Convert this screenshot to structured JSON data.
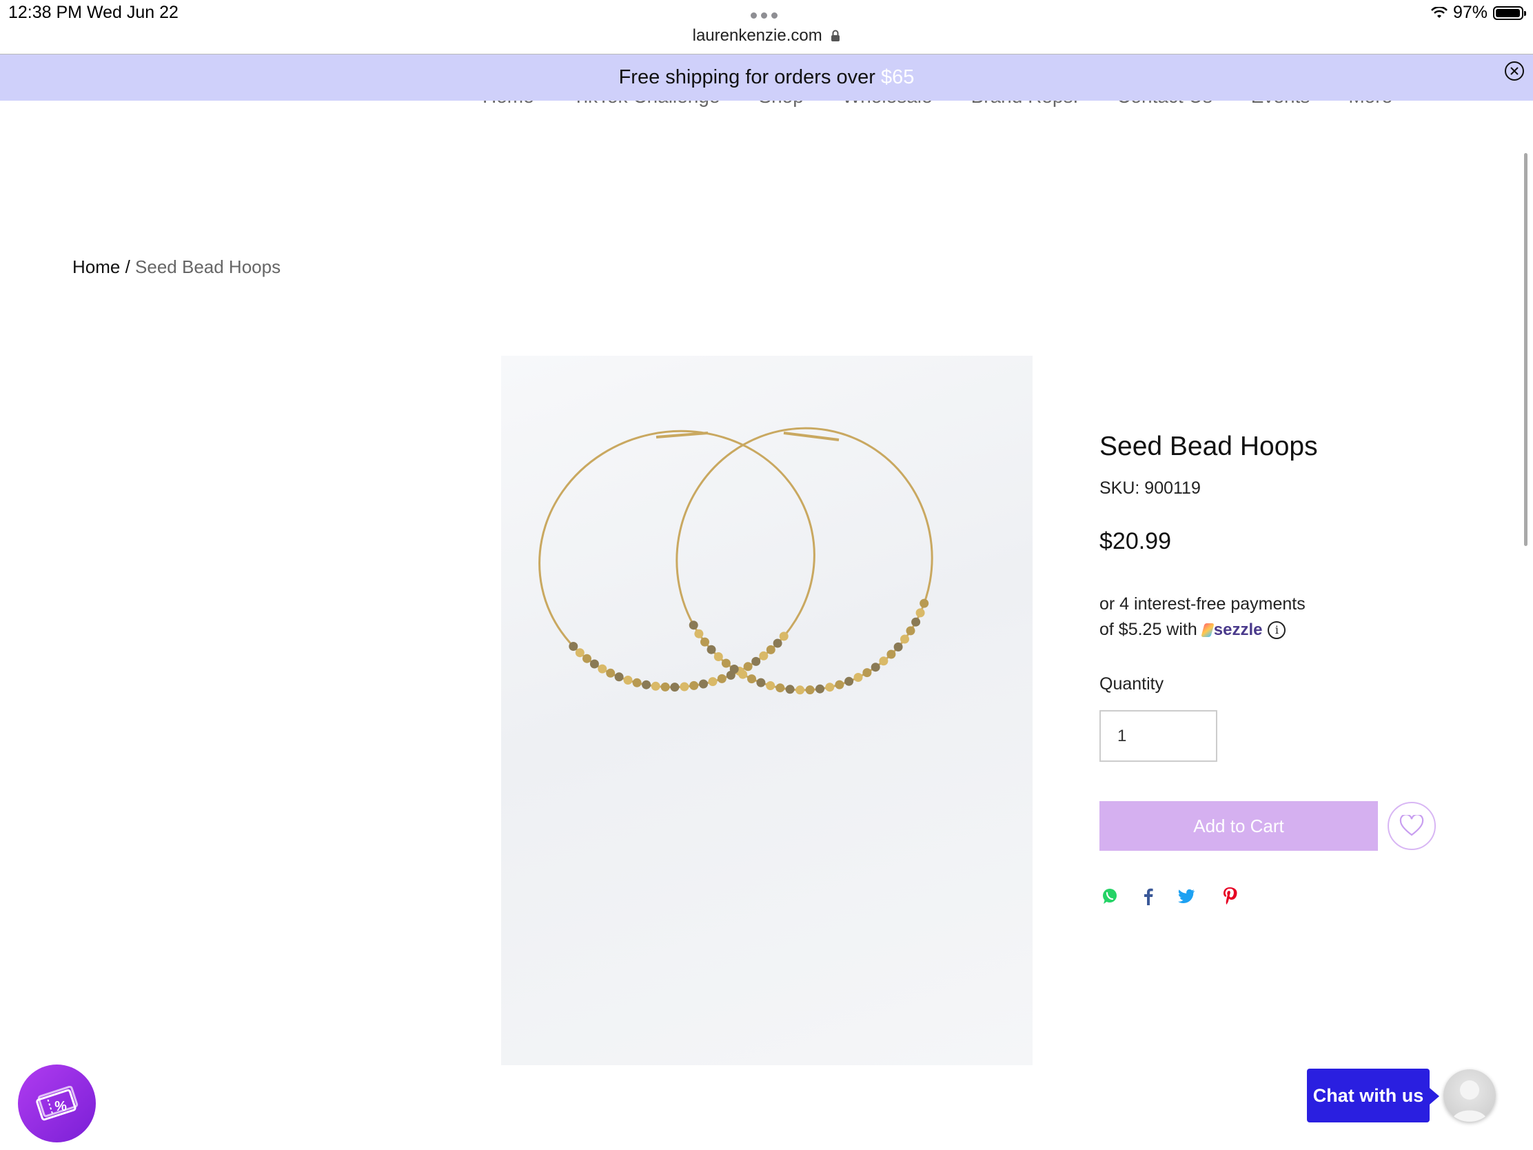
{
  "status_bar": {
    "time_date": "12:38 PM   Wed Jun 22",
    "battery_text": "97%",
    "battery_level": 0.97
  },
  "browser": {
    "url": "laurenkenzie.com"
  },
  "promo": {
    "text_prefix": "Free shipping for orders over ",
    "amount": "$65",
    "accent_color": "#ffffff",
    "background_color": "#cfd0fa"
  },
  "nav": {
    "items": [
      "Home",
      "TikTok Challenge",
      "Shop",
      "Wholesale",
      "Brand Reps.",
      "Contact Us",
      "Events",
      "More"
    ]
  },
  "breadcrumb": {
    "home": "Home",
    "separator": " / ",
    "current": "Seed Bead Hoops"
  },
  "product": {
    "title": "Seed Bead Hoops",
    "sku": "SKU: 900119",
    "price": "$20.99",
    "installments_line1": "or 4 interest-free payments",
    "installments_line2": "of $5.25 with",
    "sezzle_brand": "sezzle",
    "info_glyph": "i",
    "quantity_label": "Quantity",
    "quantity_value": "1",
    "add_to_cart": "Add to Cart",
    "add_to_cart_color": "#d5b0f0"
  },
  "share_icons": [
    "whatsapp-icon",
    "facebook-icon",
    "twitter-icon",
    "pinterest-icon"
  ],
  "chat": {
    "label": "Chat with us",
    "color": "#2a1fe0"
  },
  "coupon": {
    "glyph": "%"
  }
}
